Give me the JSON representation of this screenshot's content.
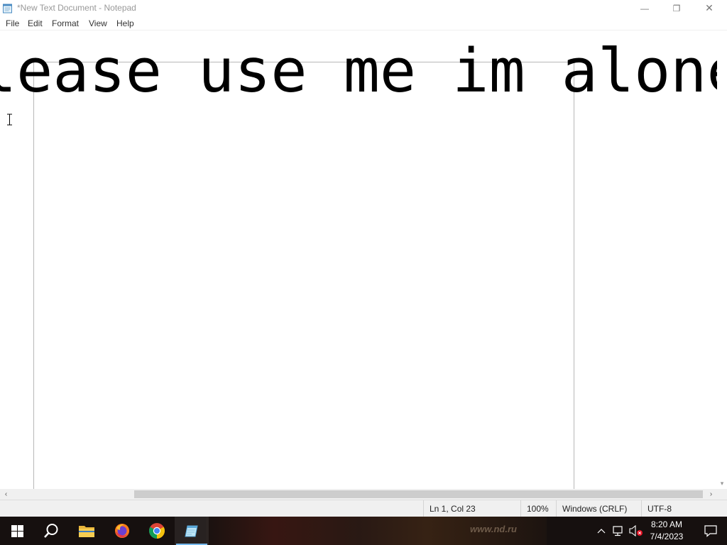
{
  "window": {
    "title": "*New Text Document - Notepad",
    "minimize_glyph": "—",
    "maximize_glyph": "❐",
    "close_glyph": "✕"
  },
  "menu": {
    "items": [
      "File",
      "Edit",
      "Format",
      "View",
      "Help"
    ]
  },
  "editor": {
    "text": "lease use me im alone"
  },
  "scrollbar": {
    "left_arrow": "‹",
    "right_arrow": "›",
    "down_arrow": "▾"
  },
  "status": {
    "position": "Ln 1, Col 23",
    "zoom": "100%",
    "line_ending": "Windows (CRLF)",
    "encoding": "UTF-8"
  },
  "taskbar": {
    "pinned": [
      "start-icon",
      "search-icon",
      "file-explorer-icon",
      "firefox-icon",
      "chrome-icon",
      "notepad-icon"
    ],
    "active_app": "Notepad",
    "wallpaper_text": "www.nd.ru",
    "clock_time": "8:20 AM",
    "clock_date": "7/4/2023"
  },
  "colors": {
    "taskbar": "#16100f",
    "accent": "#76b9ed",
    "status_bar": "#f0f0f0"
  }
}
